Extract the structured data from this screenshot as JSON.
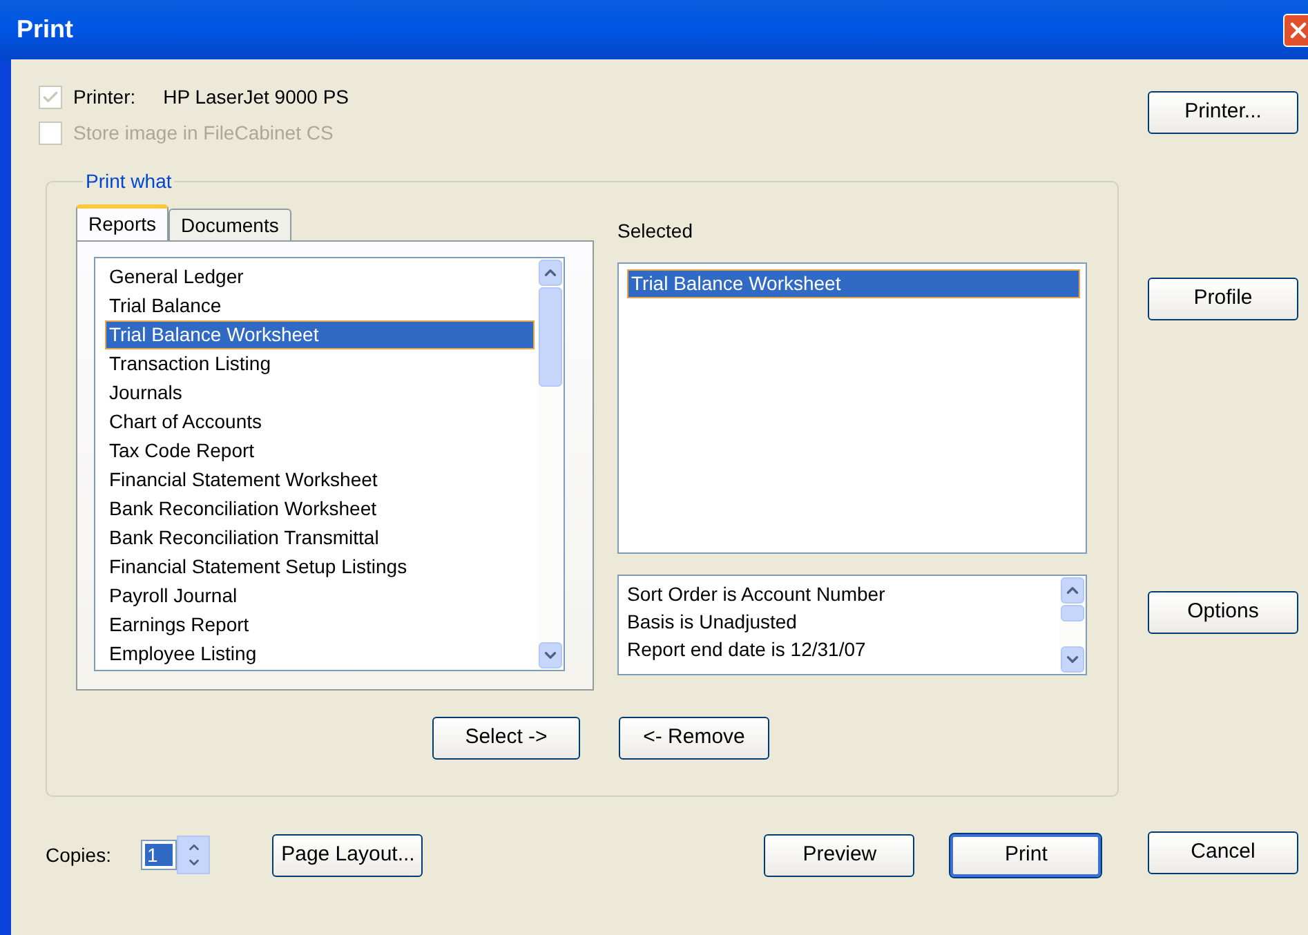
{
  "window": {
    "title": "Print"
  },
  "printer": {
    "label": "Printer:",
    "name": "HP LaserJet 9000 PS",
    "checked": true,
    "disabled": true
  },
  "store_image": {
    "label": "Store image in FileCabinet CS",
    "checked": false,
    "disabled": true
  },
  "side_buttons": [
    "Printer...",
    "Profile",
    "Options"
  ],
  "group": {
    "title": "Print what"
  },
  "tabs": [
    {
      "label": "Reports",
      "selected": true
    },
    {
      "label": "Documents",
      "selected": false
    }
  ],
  "reports": [
    {
      "label": "General Ledger",
      "selected": false
    },
    {
      "label": "Trial Balance",
      "selected": false
    },
    {
      "label": "Trial Balance Worksheet",
      "selected": true
    },
    {
      "label": "Transaction Listing",
      "selected": false
    },
    {
      "label": "Journals",
      "selected": false
    },
    {
      "label": "Chart of Accounts",
      "selected": false
    },
    {
      "label": "Tax Code Report",
      "selected": false
    },
    {
      "label": "Financial Statement Worksheet",
      "selected": false
    },
    {
      "label": "Bank Reconciliation Worksheet",
      "selected": false
    },
    {
      "label": "Bank Reconciliation Transmittal",
      "selected": false
    },
    {
      "label": "Financial Statement Setup Listings",
      "selected": false
    },
    {
      "label": "Payroll Journal",
      "selected": false
    },
    {
      "label": "Earnings Report",
      "selected": false
    },
    {
      "label": "Employee Listing",
      "selected": false
    }
  ],
  "selected_label": "Selected",
  "selected_items": [
    {
      "label": "Trial Balance Worksheet",
      "selected": true
    }
  ],
  "options_summary": [
    "Sort Order is Account Number",
    "Basis is Unadjusted",
    "Report end date is 12/31/07"
  ],
  "select_button": "Select ->",
  "remove_button": "<- Remove",
  "copies": {
    "label": "Copies:",
    "value": "1"
  },
  "page_layout_button": "Page Layout...",
  "bottom_buttons": [
    {
      "label": "Preview",
      "default": false
    },
    {
      "label": "Print",
      "default": true
    },
    {
      "label": "Cancel",
      "default": false
    }
  ]
}
